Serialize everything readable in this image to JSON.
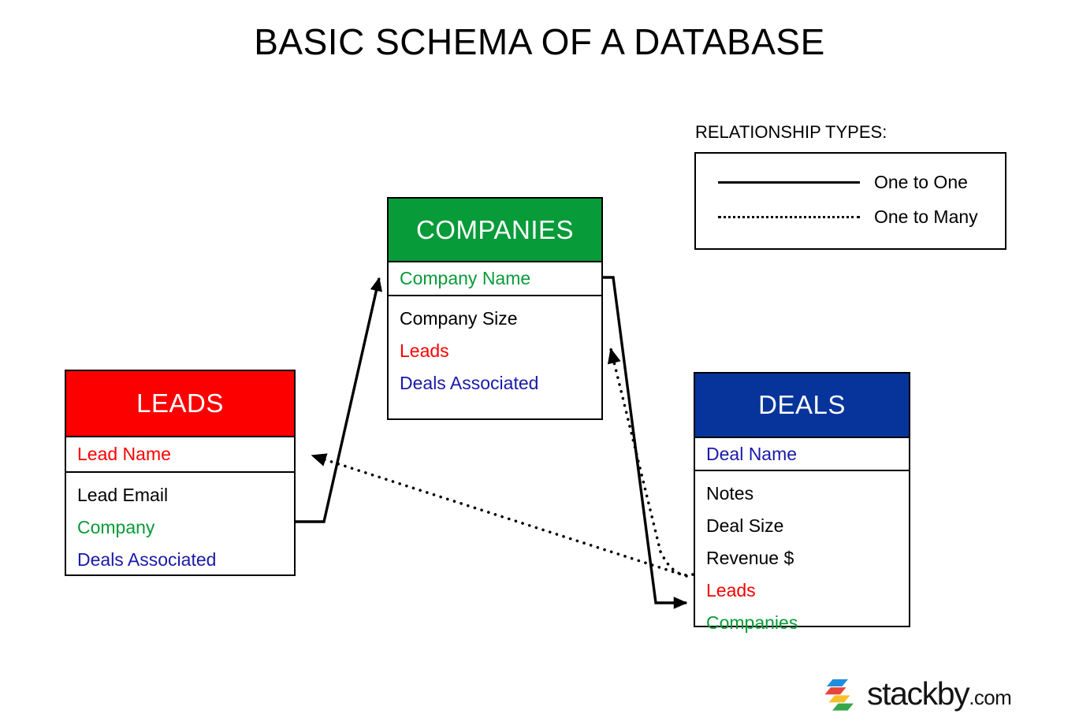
{
  "page": {
    "title": "BASIC SCHEMA OF A DATABASE",
    "background": "#ffffff"
  },
  "legend": {
    "title": "RELATIONSHIP TYPES:",
    "items": [
      {
        "style": "solid",
        "label": "One to One"
      },
      {
        "style": "dotted",
        "label": "One to Many"
      }
    ]
  },
  "colors": {
    "leads": "#fc0000",
    "companies": "#089b39",
    "deals": "#06349b",
    "field_red": "#fc0000",
    "field_green": "#089b39",
    "field_blue": "#1a1aa8",
    "field_black": "#000000",
    "stroke": "#000000"
  },
  "entities": [
    {
      "id": "leads",
      "name": "LEADS",
      "header_color": "#fc0000",
      "primary_field": {
        "label": "Lead Name",
        "color": "#fc0000"
      },
      "fields": [
        {
          "label": "Lead Email",
          "color": "#000000"
        },
        {
          "label": "Company",
          "color": "#089b39"
        },
        {
          "label": "Deals Associated",
          "color": "#1a1aa8"
        }
      ]
    },
    {
      "id": "companies",
      "name": "COMPANIES",
      "header_color": "#089b39",
      "primary_field": {
        "label": "Company Name",
        "color": "#089b39"
      },
      "fields": [
        {
          "label": "Company Size",
          "color": "#000000"
        },
        {
          "label": "Leads",
          "color": "#fc0000"
        },
        {
          "label": "Deals Associated",
          "color": "#1a1aa8"
        }
      ]
    },
    {
      "id": "deals",
      "name": "DEALS",
      "header_color": "#06349b",
      "primary_field": {
        "label": "Deal Name",
        "color": "#1a1aa8"
      },
      "fields": [
        {
          "label": "Notes",
          "color": "#000000"
        },
        {
          "label": "Deal Size",
          "color": "#000000"
        },
        {
          "label": "Revenue $",
          "color": "#000000"
        },
        {
          "label": "Leads",
          "color": "#fc0000"
        },
        {
          "label": "Companies",
          "color": "#089b39"
        }
      ]
    }
  ],
  "relationships": [
    {
      "id": "leads-company-to-companies",
      "from": "leads.Company",
      "to": "companies.Company Name",
      "type": "One to One"
    },
    {
      "id": "companies-name-to-deals",
      "from": "companies.Company Name",
      "to": "deals.Companies",
      "type": "One to One"
    },
    {
      "id": "deals-leads-to-companies",
      "from": "deals.Leads",
      "to": "companies.Leads",
      "type": "One to Many"
    },
    {
      "id": "deals-leads-to-leads",
      "from": "deals.Leads",
      "to": "leads.Lead Name",
      "type": "One to Many"
    }
  ],
  "branding": {
    "name": "stackby",
    "tld": ".com",
    "mark_colors": [
      "#1f8ede",
      "#e8443a",
      "#f5c12b",
      "#35a84c"
    ]
  }
}
